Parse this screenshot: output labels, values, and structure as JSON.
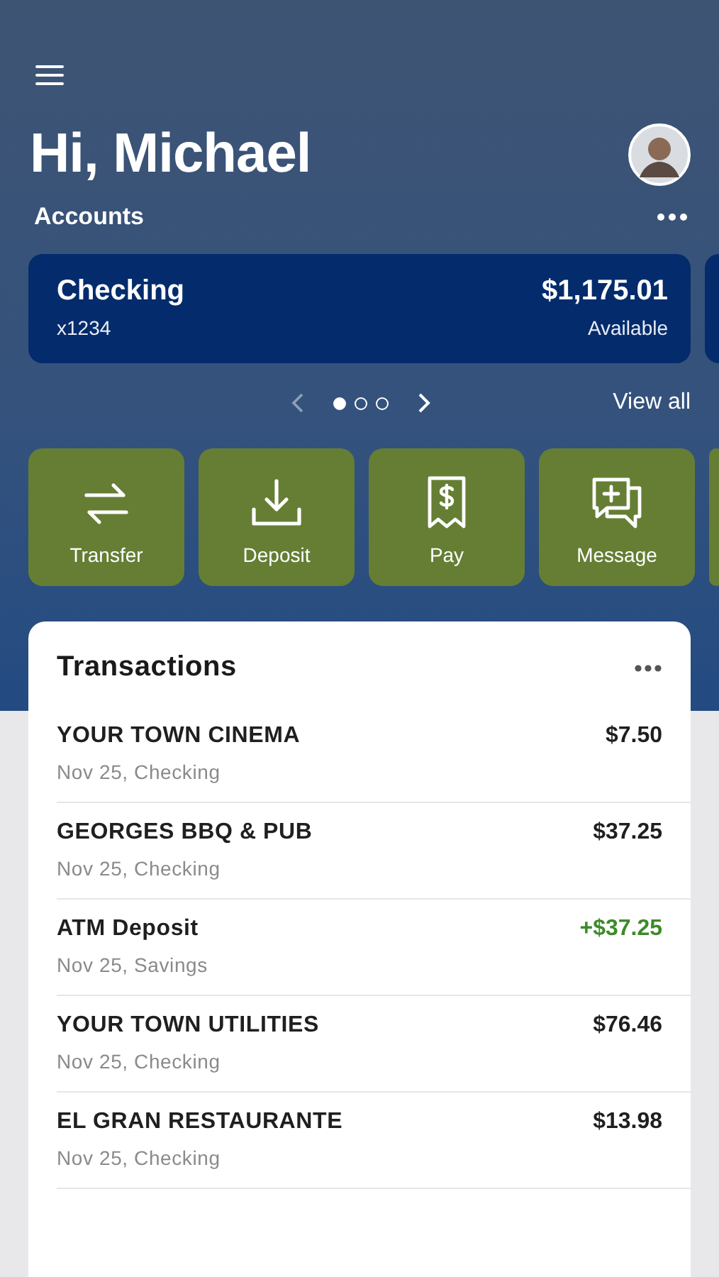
{
  "greeting": "Hi, Michael",
  "accounts": {
    "title": "Accounts",
    "items": [
      {
        "name": "Checking",
        "number": "x1234",
        "balance": "$1,175.01",
        "note": "Available"
      }
    ],
    "pager": [
      {
        "selected": true
      },
      {
        "selected": false
      },
      {
        "selected": false
      }
    ],
    "view_all": "View all"
  },
  "actions": [
    {
      "kind": "transfer",
      "label": "Transfer"
    },
    {
      "kind": "deposit",
      "label": "Deposit"
    },
    {
      "kind": "pay",
      "label": "Pay"
    },
    {
      "kind": "message",
      "label": "Message"
    }
  ],
  "transactions": {
    "title": "Transactions",
    "rows": [
      {
        "name": "YOUR TOWN CINEMA",
        "detail": "Nov 25, Checking",
        "amount": "$7.50",
        "kind": "debit"
      },
      {
        "name": "GEORGES BBQ & PUB",
        "detail": "Nov 25, Checking",
        "amount": "$37.25",
        "kind": "debit"
      },
      {
        "name": "ATM Deposit",
        "detail": "Nov 25, Savings",
        "amount": "+$37.25",
        "kind": "credit"
      },
      {
        "name": "YOUR TOWN UTILITIES",
        "detail": "Nov 25, Checking",
        "amount": "$76.46",
        "kind": "debit"
      },
      {
        "name": "EL GRAN RESTAURANTE",
        "detail": "Nov 25, Checking",
        "amount": "$13.98",
        "kind": "debit"
      }
    ]
  }
}
